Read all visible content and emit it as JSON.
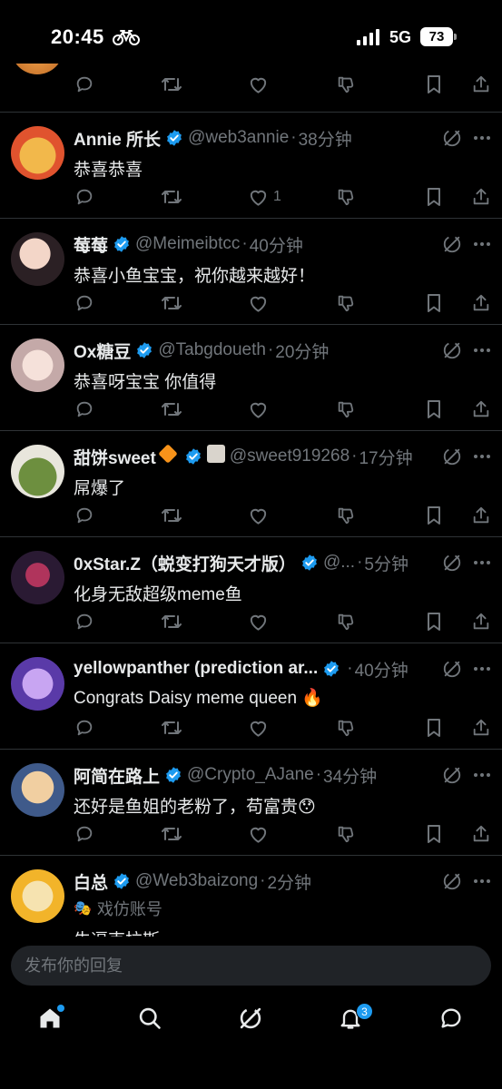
{
  "status_bar": {
    "time": "20:45",
    "network": "5G",
    "battery": "73"
  },
  "colors": {
    "background": "#000000",
    "verified": "#1d9bf0",
    "secondary_text": "#71767b",
    "divider": "#2f3336",
    "composer_bg": "#202327"
  },
  "posts": [
    {
      "name": "Annie 所长",
      "handle": "@web3annie",
      "sep": "·",
      "age": "38分钟",
      "text": "恭喜恭喜",
      "like_count": "1"
    },
    {
      "name": "莓莓",
      "handle": "@Meimeibtcc",
      "sep": "·",
      "age": "40分钟",
      "text": "恭喜小鱼宝宝，祝你越来越好！",
      "like_count": ""
    },
    {
      "name": "Ox糖豆",
      "handle": "@Tabgdoueth",
      "sep": "·",
      "age": "20分钟",
      "text": "恭喜呀宝宝 你值得",
      "like_count": ""
    },
    {
      "name": "甜饼sweet",
      "handle": "@sweet919268",
      "sep": "·",
      "age": "17分钟",
      "text": "屌爆了",
      "like_count": ""
    },
    {
      "name": "0xStar.Z（蜕变打狗天才版）",
      "handle": "@...",
      "sep": "·",
      "age": "5分钟",
      "text": "化身无敌超级meme鱼",
      "like_count": ""
    },
    {
      "name": "yellowpanther (prediction ar...",
      "handle": "",
      "sep": "·",
      "age": "40分钟",
      "text": "Congrats Daisy meme queen 🔥",
      "like_count": ""
    },
    {
      "name": "阿简在路上",
      "handle": "@Crypto_AJane",
      "sep": "·",
      "age": "34分钟",
      "text": "还好是鱼姐的老粉了，苟富贵😯",
      "like_count": ""
    },
    {
      "name": "白总",
      "handle": "@Web3baizong",
      "sep": "·",
      "age": "2分钟",
      "label": "戏仿账号",
      "text": "牛逼克拉斯",
      "like_count": ""
    }
  ],
  "composer": {
    "placeholder": "发布你的回复"
  },
  "tabbar": {
    "notifications_count": "3"
  },
  "icons": [
    "reply-icon",
    "retweet-icon",
    "like-icon",
    "dislike-icon",
    "bookmark-icon",
    "share-icon",
    "grok-icon",
    "more-icon",
    "verified-icon",
    "home-icon",
    "search-icon",
    "notifications-icon",
    "messages-icon"
  ]
}
